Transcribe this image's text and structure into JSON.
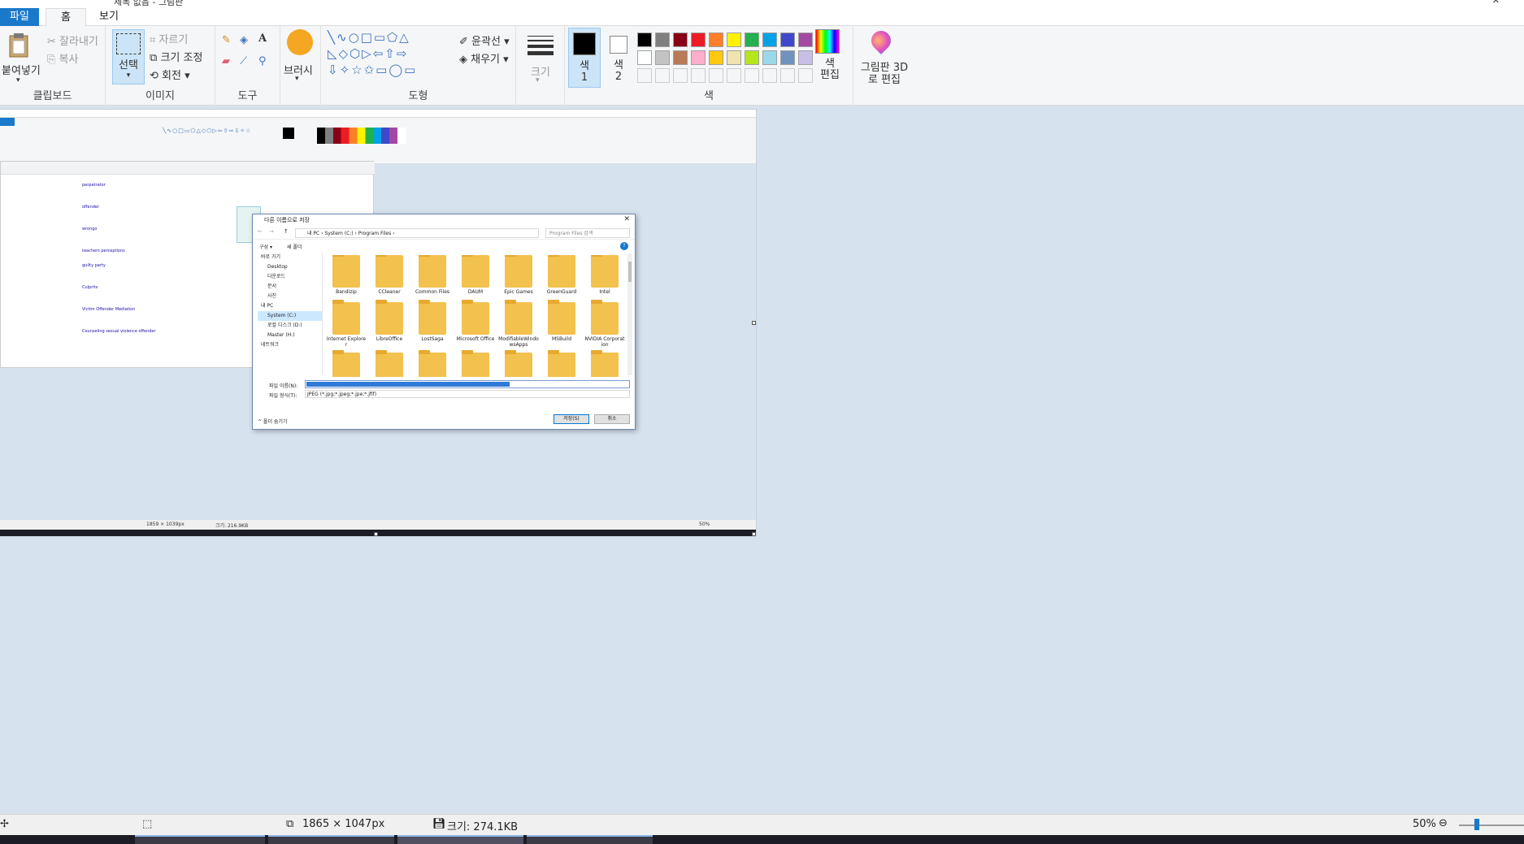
{
  "window": {
    "title": "제목 없음 - 그림판"
  },
  "tabs": {
    "file": "파일",
    "home": "홈",
    "view": "보기"
  },
  "clipboard": {
    "paste": "붙여넣기",
    "cut": "잘라내기",
    "copy": "복사",
    "label": "클립보드"
  },
  "image": {
    "select": "선택",
    "crop": "자르기",
    "resize": "크기 조정",
    "rotate": "회전",
    "label": "이미지"
  },
  "tools": {
    "label": "도구"
  },
  "brushes": {
    "label": "브러시"
  },
  "shapes": {
    "outline": "윤곽선",
    "fill": "채우기",
    "label": "도형"
  },
  "size": {
    "label": "크기"
  },
  "colors": {
    "color1": "색\n1",
    "color2": "색\n2",
    "edit": "색\n편집",
    "label": "색",
    "palette_row1": [
      "#000000",
      "#7f7f7f",
      "#880015",
      "#ed1c24",
      "#ff7f27",
      "#fff200",
      "#22b14c",
      "#00a2e8",
      "#3f48cc",
      "#a349a4"
    ],
    "palette_row2": [
      "#ffffff",
      "#c3c3c3",
      "#b97a57",
      "#ffaec9",
      "#ffc90e",
      "#efe4b0",
      "#b5e61d",
      "#99d9ea",
      "#7092be",
      "#c8bfe7"
    ]
  },
  "paint3d": {
    "label": "그림판 3D로 편집"
  },
  "status": {
    "dimensions": "1865 × 1047px",
    "size": "크기: 274.1KB",
    "zoom": "50%"
  },
  "dialog": {
    "title": "다른 이름으로 저장",
    "path": "내 PC › System (C:) › Program Files ›",
    "search_placeholder": "Program Files 검색",
    "organize": "구성 ▾",
    "new_folder": "새 폴더",
    "tree": [
      "바로 가기",
      "Desktop",
      "다운로드",
      "문서",
      "사진",
      "내 PC",
      "System (C:)",
      "로컬 디스크 (D:)",
      "Master (H:)",
      "네트워크"
    ],
    "folders": [
      "Bandizip",
      "CCleaner",
      "Common Files",
      "DAUM",
      "Epic Games",
      "GreenGuard",
      "Intel",
      "Internet Explorer",
      "LibreOffice",
      "LostSaga",
      "Microsoft Office",
      "ModifiableWindowsApps",
      "MSBuild",
      "NVIDIA Corporation"
    ],
    "filename_label": "파일 이름(N):",
    "filetype_label": "파일 형식(T):",
    "filetype_value": "JPEG (*.jpg;*.jpeg;*.jpe;*.jfif)",
    "hide_folders": "^ 폴더 숨기기",
    "save": "저장(S)",
    "cancel": "취소"
  },
  "mini": {
    "status_dims": "1859 × 1039px",
    "status_size": "크기: 216.9KB",
    "zoom": "50%"
  }
}
